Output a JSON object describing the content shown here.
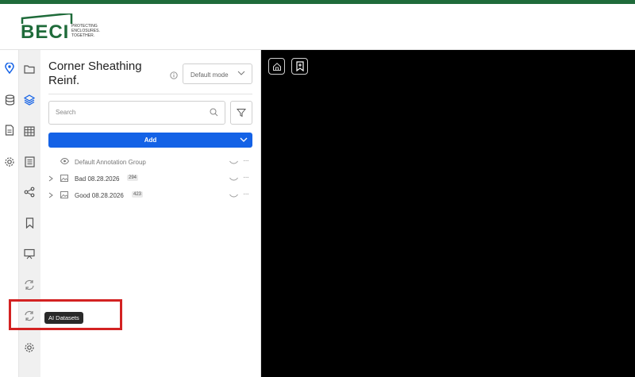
{
  "brand": {
    "logo_text": "BECI",
    "tagline": "PROTECTING ENCLOSURES. TOGETHER.",
    "accent_color": "#1f6b3a"
  },
  "left_rail": {
    "items": [
      {
        "icon": "map-pin-icon"
      },
      {
        "icon": "database-icon"
      },
      {
        "icon": "document-icon"
      },
      {
        "icon": "settings-gear-icon"
      }
    ]
  },
  "tool_rail": {
    "items": [
      {
        "icon": "folder-icon"
      },
      {
        "icon": "layers-icon",
        "active": true
      },
      {
        "icon": "table-icon"
      },
      {
        "icon": "list-icon"
      },
      {
        "icon": "share-icon"
      },
      {
        "icon": "bookmark-icon"
      },
      {
        "icon": "presentation-icon"
      },
      {
        "icon": "sync-icon"
      },
      {
        "icon": "ai-datasets-sync-icon"
      },
      {
        "icon": "gear-icon"
      }
    ]
  },
  "panel": {
    "title": "Corner Sheathing Reinf.",
    "mode_select": "Default mode",
    "search_placeholder": "Search",
    "add_label": "Add",
    "add_color": "#1462e6",
    "tree": [
      {
        "label": "Default Annotation Group",
        "count": "",
        "icon": "eye-icon"
      },
      {
        "label": "Bad 08.28.2026",
        "count": "294",
        "icon": "image-icon"
      },
      {
        "label": "Good 08.28.2026",
        "count": "423",
        "icon": "image-icon"
      }
    ]
  },
  "viewer": {
    "buttons": [
      {
        "icon": "home-icon"
      },
      {
        "icon": "bookmark-plus-icon"
      }
    ]
  },
  "tooltip": {
    "text": "AI Datasets"
  }
}
